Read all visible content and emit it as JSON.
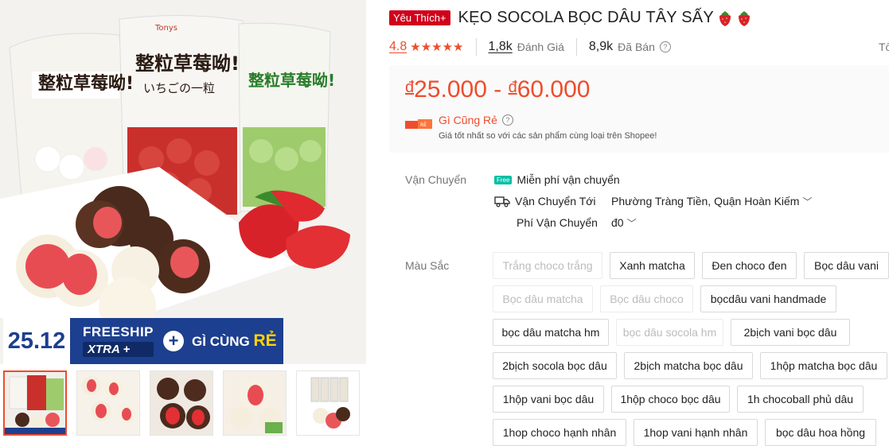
{
  "gallery": {
    "promo": {
      "date": "25.12",
      "freeship": "FREESHIP",
      "xtra": "XTRA",
      "cheap_text": "GÌ CÙNG",
      "cheap_bold": "RẺ",
      "plus": "+"
    },
    "pack_text": {
      "cn_title": "整粒草莓呦!",
      "jp": "いちごの一粒",
      "brand": "Tonys"
    },
    "thumbnails": 5
  },
  "product": {
    "badge": "Yêu Thích+",
    "title": "KẸO SOCOLA BỌC DÂU TÂY SẤY",
    "emoji_icon": "strawberry-icon"
  },
  "stats": {
    "rating": "4.8",
    "stars": "★★★★★",
    "reviews_count": "1,8k",
    "reviews_label": "Đánh Giá",
    "sold_count": "8,9k",
    "sold_label": "Đã Bán",
    "help": "?",
    "cut_off": "Tố"
  },
  "price": {
    "currency": "đ",
    "min": "25.000",
    "dash": "-",
    "max": "60.000",
    "cheap_title": "Gì Cũng Rẻ",
    "cheap_desc": "Giá tốt nhất so với các sản phẩm cùng loại trên Shopee!"
  },
  "shipping": {
    "label": "Vận Chuyển",
    "free_tag": "Free",
    "free_text": "Miễn phí vận chuyển",
    "to_label": "Vận Chuyển Tới",
    "to_value": "Phường Tràng Tiền, Quận Hoàn Kiếm",
    "fee_label": "Phí Vận Chuyển",
    "fee_value": "đ0",
    "chevron": "﹀"
  },
  "variations": {
    "label": "Màu Sắc",
    "options": [
      {
        "label": "Trắng choco trắng",
        "disabled": true
      },
      {
        "label": "Xanh matcha",
        "disabled": false
      },
      {
        "label": "Đen choco đen",
        "disabled": false
      },
      {
        "label": "Bọc dâu vani",
        "disabled": false
      },
      {
        "label": "Bọc dâu matcha",
        "disabled": true
      },
      {
        "label": "Bọc dâu choco",
        "disabled": true
      },
      {
        "label": "bọcdâu vani handmade",
        "disabled": false
      },
      {
        "label": "bọc dâu matcha hm",
        "disabled": false
      },
      {
        "label": "bọc dâu socola hm",
        "disabled": true
      },
      {
        "label": "2bịch vani bọc dâu",
        "disabled": false
      },
      {
        "label": "2bịch socola bọc dâu",
        "disabled": false
      },
      {
        "label": "2bịch matcha bọc dâu",
        "disabled": false
      },
      {
        "label": "1hộp matcha bọc dâu",
        "disabled": false
      },
      {
        "label": "1hộp vani bọc dâu",
        "disabled": false
      },
      {
        "label": "1hộp choco bọc dâu",
        "disabled": false
      },
      {
        "label": "1h chocoball phủ dâu",
        "disabled": false
      },
      {
        "label": "1hop choco hạnh nhân",
        "disabled": false
      },
      {
        "label": "1hop vani hạnh nhân",
        "disabled": false
      },
      {
        "label": "bọc dâu hoa hồng",
        "disabled": false
      }
    ]
  },
  "colors": {
    "accent": "#ee4d2d",
    "badge": "#d0011b",
    "banner_blue": "#1d3f8f",
    "free_green": "#00bfa5"
  }
}
